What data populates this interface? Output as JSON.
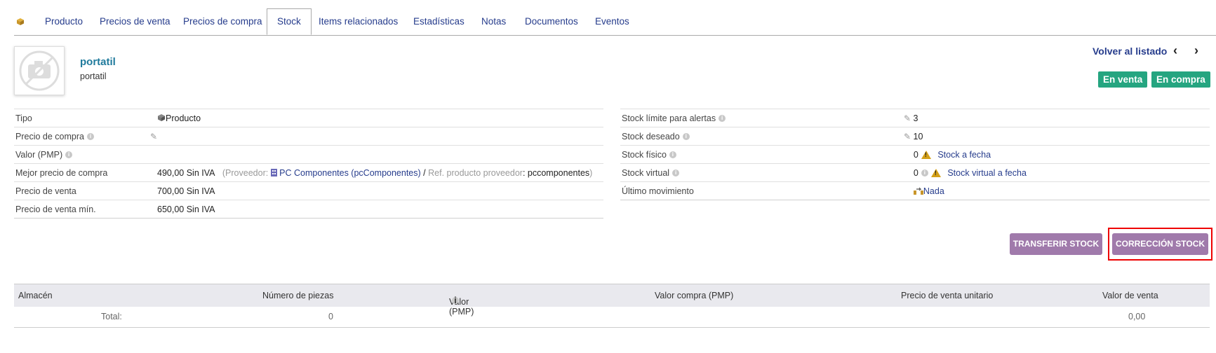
{
  "tabs": [
    {
      "label": ""
    },
    {
      "label": "Producto"
    },
    {
      "label": "Precios de venta"
    },
    {
      "label": "Precios de compra"
    },
    {
      "label": "Stock"
    },
    {
      "label": "Items relacionados"
    },
    {
      "label": "Estadísticas"
    },
    {
      "label": "Notas"
    },
    {
      "label": "Documentos"
    },
    {
      "label": "Eventos"
    }
  ],
  "header": {
    "ref": "portatil",
    "label": "portatil",
    "back_link": "Volver al listado",
    "prev": "‹",
    "next": "›",
    "badge_sell": "En venta",
    "badge_buy": "En compra"
  },
  "left_fields": {
    "tipo": {
      "label": "Tipo",
      "value": "Producto"
    },
    "precio_compra": {
      "label": "Precio de compra"
    },
    "valor_pmp": {
      "label": "Valor (PMP)"
    },
    "mejor_precio": {
      "label": "Mejor precio de compra",
      "value": "490,00 Sin IVA",
      "proveedor_label": "(Proveedor:",
      "proveedor": "PC Componentes (pcComponentes)",
      "slash": "/",
      "ref_label": "Ref. producto proveedor",
      "ref_value": "pccomponentes",
      "close": ")"
    },
    "precio_venta": {
      "label": "Precio de venta",
      "value": "700,00 Sin IVA"
    },
    "precio_venta_min": {
      "label": "Precio de venta mín.",
      "value": "650,00 Sin IVA"
    }
  },
  "right_fields": {
    "stock_limite": {
      "label": "Stock límite para alertas",
      "value": "3"
    },
    "stock_deseado": {
      "label": "Stock deseado",
      "value": "10"
    },
    "stock_fisico": {
      "label": "Stock físico",
      "value": "0",
      "link": "Stock a fecha"
    },
    "stock_virtual": {
      "label": "Stock virtual",
      "value": "0",
      "link": "Stock virtual a fecha"
    },
    "ultimo_mov": {
      "label": "Último movimiento",
      "link": "Nada"
    }
  },
  "buttons": {
    "transferir": "TRANSFERIR STOCK",
    "correccion": "CORRECCIÓN STOCK"
  },
  "stock_table": {
    "headers": [
      "Almacén",
      "Número de piezas",
      "Valor (PMP)",
      "Valor compra (PMP)",
      "Precio de venta unitario",
      "Valor de venta"
    ],
    "total_label": "Total:",
    "total_pieces": "0",
    "total_value": "0,00"
  },
  "colors": {
    "accent": "#263c8c",
    "badge": "#25a580",
    "button": "#a07aab",
    "highlight": "#ee0000"
  }
}
